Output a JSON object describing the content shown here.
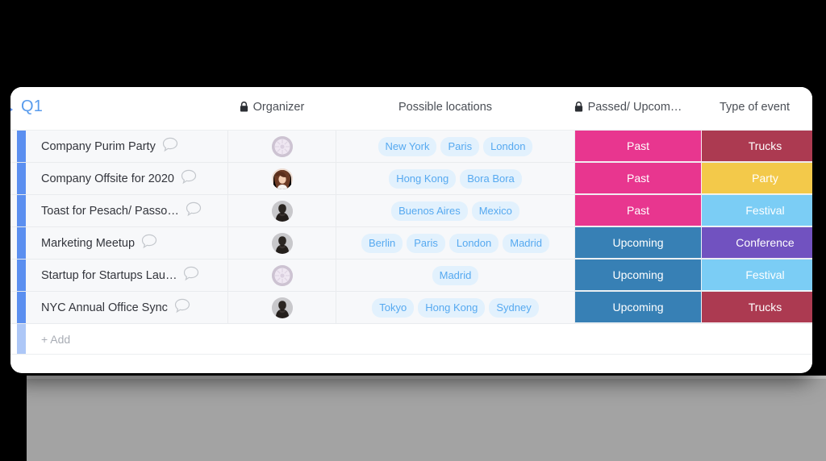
{
  "board": {
    "group_title": "Q1",
    "collapse_icon": "triangle-right-icon",
    "add_row_label": "+ Add"
  },
  "columns": [
    {
      "key": "name",
      "label": "",
      "locked": false,
      "icon": null
    },
    {
      "key": "organizer",
      "label": "Organizer",
      "locked": true,
      "icon": "lock-icon"
    },
    {
      "key": "locations",
      "label": "Possible locations",
      "locked": false,
      "icon": null
    },
    {
      "key": "status",
      "label": "Passed/ Upcom…",
      "locked": true,
      "icon": "lock-icon"
    },
    {
      "key": "type",
      "label": "Type of event",
      "locked": false,
      "icon": null
    }
  ],
  "colors": {
    "group_bar": "#5b8ff0",
    "add_bar": "#adc7f7",
    "chip_bg": "#e2f1fd",
    "chip_text": "#56a9f0",
    "title_text": "#589bed",
    "status_past": "#e8368f",
    "status_upcoming": "#3780b5",
    "type_trucks": "#ac3a51",
    "type_party": "#f3c94a",
    "type_festival": "#7bcdf5",
    "type_conference": "#7152c0"
  },
  "rows": [
    {
      "name": "Company Purim Party",
      "comment_icon": "comment-bubble-icon",
      "avatar": "avatar-flower",
      "locations": [
        "New York",
        "Paris",
        "London"
      ],
      "status": {
        "label": "Past",
        "color": "#e8368f"
      },
      "type": {
        "label": "Trucks",
        "color": "#ac3a51"
      }
    },
    {
      "name": "Company Offsite for 2020",
      "comment_icon": "comment-bubble-icon",
      "avatar": "avatar-woman-brown-hair",
      "locations": [
        "Hong Kong",
        "Bora Bora"
      ],
      "status": {
        "label": "Past",
        "color": "#e8368f"
      },
      "type": {
        "label": "Party",
        "color": "#f3c94a"
      }
    },
    {
      "name": "Toast for Pesach/ Passo…",
      "comment_icon": "comment-bubble-icon",
      "avatar": "avatar-person-dark",
      "locations": [
        "Buenos Aires",
        "Mexico"
      ],
      "status": {
        "label": "Past",
        "color": "#e8368f"
      },
      "type": {
        "label": "Festival",
        "color": "#7bcdf5"
      }
    },
    {
      "name": "Marketing Meetup",
      "comment_icon": "comment-bubble-icon",
      "avatar": "avatar-person-dark",
      "locations": [
        "Berlin",
        "Paris",
        "London",
        "Madrid"
      ],
      "status": {
        "label": "Upcoming",
        "color": "#3780b5"
      },
      "type": {
        "label": "Conference",
        "color": "#7152c0"
      }
    },
    {
      "name": "Startup for Startups Lau…",
      "comment_icon": "comment-bubble-icon",
      "avatar": "avatar-flower",
      "locations": [
        "Madrid"
      ],
      "status": {
        "label": "Upcoming",
        "color": "#3780b5"
      },
      "type": {
        "label": "Festival",
        "color": "#7bcdf5"
      }
    },
    {
      "name": "NYC Annual Office Sync",
      "comment_icon": "comment-bubble-icon",
      "avatar": "avatar-person-dark",
      "locations": [
        "Tokyo",
        "Hong Kong",
        "Sydney"
      ],
      "status": {
        "label": "Upcoming",
        "color": "#3780b5"
      },
      "type": {
        "label": "Trucks",
        "color": "#ac3a51"
      }
    }
  ]
}
